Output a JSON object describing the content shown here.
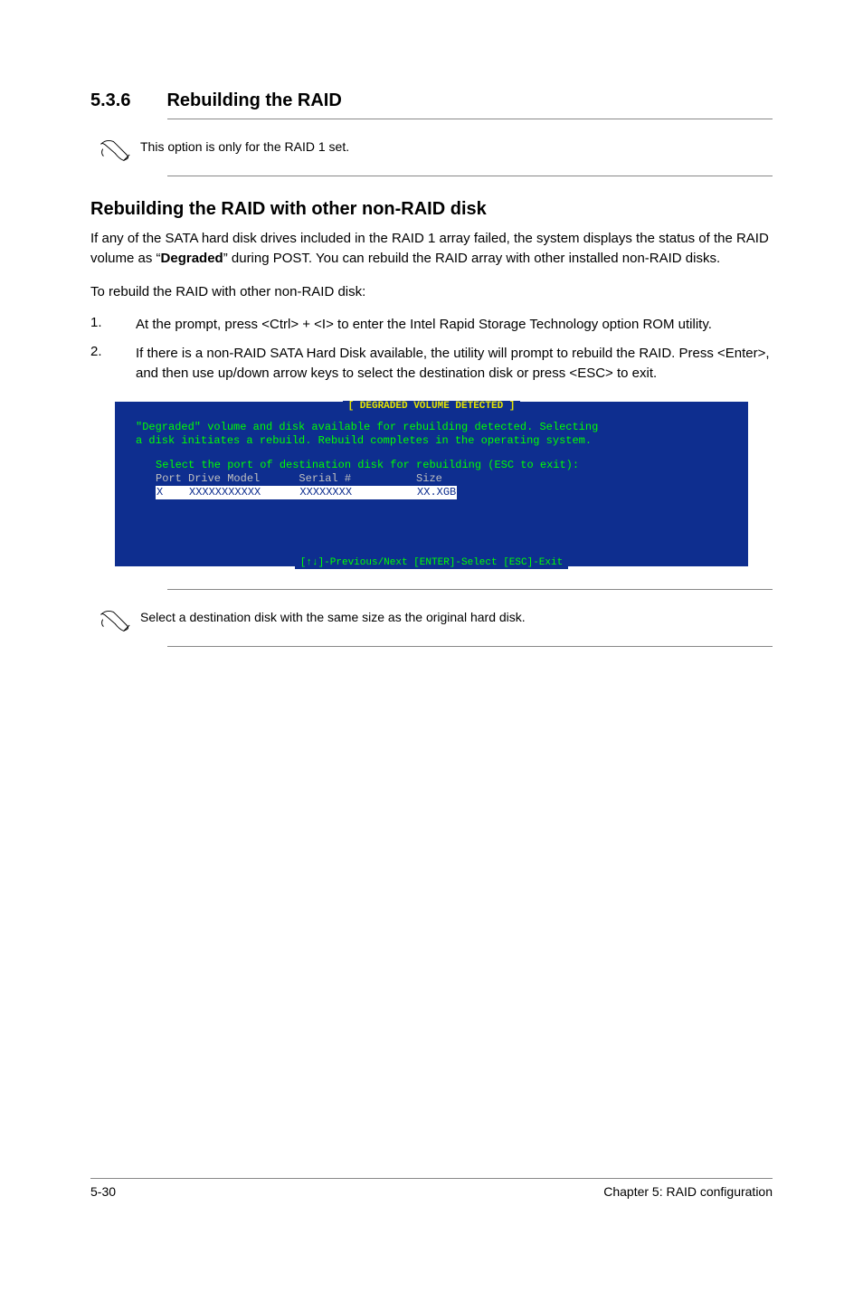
{
  "section": {
    "number": "5.3.6",
    "title": "Rebuilding the RAID"
  },
  "note1": "This option is only for the RAID 1 set.",
  "subtitle": "Rebuilding the RAID with other non-RAID disk",
  "para1_part1": "If any of the SATA hard disk drives included in the RAID 1 array failed, the system displays the status of the RAID volume as “",
  "para1_bold": "Degraded",
  "para1_part2": "” during POST. You can rebuild the RAID array with other installed non-RAID disks.",
  "para2": "To rebuild the RAID with other non-RAID disk:",
  "steps": {
    "s1": {
      "num": "1.",
      "text": "At the prompt, press <Ctrl> + <I> to enter the Intel Rapid Storage Technology option ROM utility."
    },
    "s2": {
      "num": "2.",
      "text": "If there is a non-RAID SATA Hard Disk available, the utility will prompt to rebuild the RAID. Press <Enter>, and then use up/down arrow keys to select  the destination disk or press <ESC> to exit."
    }
  },
  "terminal": {
    "header": "[ DEGRADED VOLUME DETECTED ]",
    "msg_line1": "\"Degraded\" volume and disk available for rebuilding detected. Selecting",
    "msg_line2": "a disk initiates a rebuild. Rebuild completes in the operating system.",
    "instruct": "Select the port of destination disk for rebuilding (ESC to exit):",
    "cols": "Port Drive Model      Serial #          Size",
    "row": "X    XXXXXXXXXXX      XXXXXXXX          XX.XGB",
    "footer": "[↑↓]-Previous/Next  [ENTER]-Select  [ESC]-Exit"
  },
  "note2": "Select a destination disk with the same size as the original hard disk.",
  "footer": {
    "page": "5-30",
    "chapter": "Chapter 5: RAID configuration"
  }
}
